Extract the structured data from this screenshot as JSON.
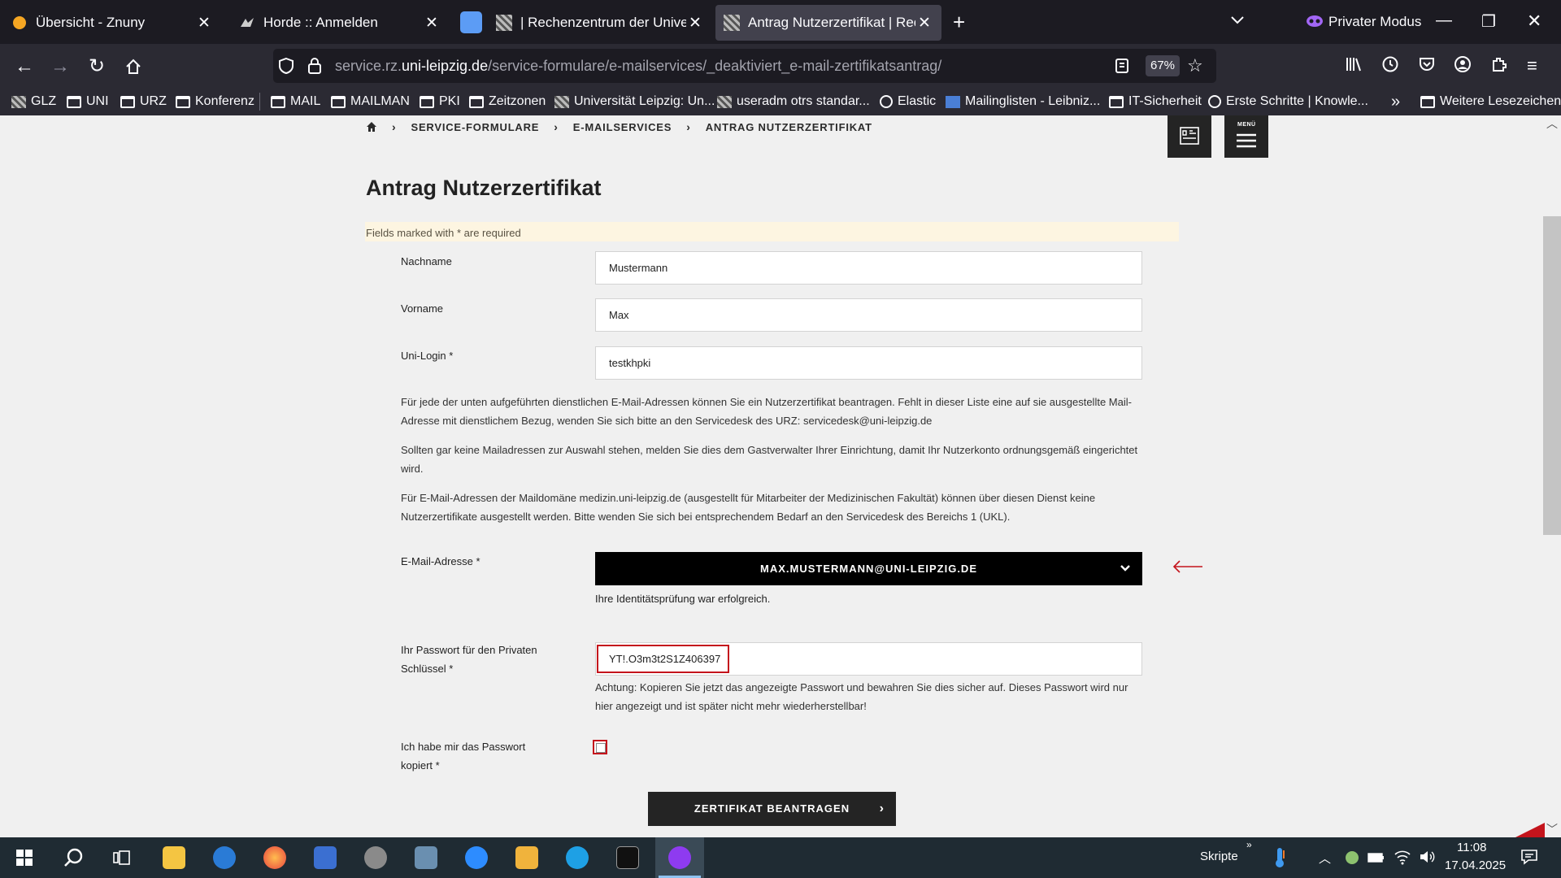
{
  "browser": {
    "tabs": [
      {
        "title": "Übersicht - Znuny",
        "active": false
      },
      {
        "title": "Horde :: Anmelden",
        "active": false
      },
      {
        "title": "| Rechenzentrum der Universität",
        "active": false
      },
      {
        "title": "Antrag Nutzerzertifikat | Rechen",
        "active": true
      }
    ],
    "private_mode_label": "Privater Modus",
    "url_prefix": "service.rz.",
    "url_domain": "uni-leipzig.de",
    "url_path": "/service-formulare/e-mailservices/_deaktiviert_e-mail-zertifikatsantrag/",
    "zoom": "67%",
    "bookmarks": [
      {
        "label": "GLZ",
        "icon": "image"
      },
      {
        "label": "UNI",
        "icon": "folder"
      },
      {
        "label": "URZ",
        "icon": "folder"
      },
      {
        "label": "Konferenz",
        "icon": "folder"
      },
      {
        "label": "MAIL",
        "icon": "folder"
      },
      {
        "label": "MAILMAN",
        "icon": "folder"
      },
      {
        "label": "PKI",
        "icon": "folder"
      },
      {
        "label": "Zeitzonen",
        "icon": "folder"
      },
      {
        "label": "Universität Leipzig: Un...",
        "icon": "image"
      },
      {
        "label": "useradm otrs standar...",
        "icon": "image"
      },
      {
        "label": "Elastic",
        "icon": "elastic"
      },
      {
        "label": "Mailinglisten - Leibniz...",
        "icon": "lrz"
      },
      {
        "label": "IT-Sicherheit",
        "icon": "folder"
      },
      {
        "label": "Erste Schritte | Knowle...",
        "icon": "globe"
      },
      {
        "label": "Weitere Lesezeichen",
        "icon": "folder"
      }
    ]
  },
  "page": {
    "breadcrumb": [
      "SERVICE-FORMULARE",
      "E-MAILSERVICES",
      "ANTRAG NUTZERZERTIFIKAT"
    ],
    "menu_label": "MENÜ",
    "title": "Antrag Nutzerzertifikat",
    "required_note": "Fields marked with * are required",
    "fields": {
      "nachname": {
        "label": "Nachname",
        "value": "Mustermann"
      },
      "vorname": {
        "label": "Vorname",
        "value": "Max"
      },
      "unilogin": {
        "label": "Uni-Login *",
        "value": "testkhpki"
      }
    },
    "paragraphs": [
      "Für jede der unten aufgeführten dienstlichen E-Mail-Adressen können Sie ein Nutzerzertifikat beantragen. Fehlt in dieser Liste eine auf sie ausgestellte Mail-Adresse mit dienstlichem Bezug, wenden Sie sich bitte an den Servicedesk des URZ: servicedesk@uni-leipzig.de",
      "Sollten gar keine Mailadressen zur Auswahl stehen, melden Sie dies dem Gastverwalter Ihrer Einrichtung, damit Ihr Nutzerkonto ordnungsgemäß eingerichtet wird.",
      "Für E-Mail-Adressen der Maildomäne medizin.uni-leipzig.de (ausgestellt für Mitarbeiter der Medizinischen Fakultät) können über diesen Dienst keine Nutzerzertifikate ausgestellt werden. Bitte wenden Sie sich bei entsprechendem Bedarf an den Servicedesk des Bereichs 1 (UKL)."
    ],
    "email": {
      "label": "E-Mail-Adresse *",
      "selected": "MAX.MUSTERMANN@UNI-LEIPZIG.DE",
      "status": "Ihre Identitätsprüfung war erfolgreich."
    },
    "password": {
      "label_line1": "Ihr Passwort für den Privaten",
      "label_line2": "Schlüssel *",
      "value": "YT!.O3m3t2S1Z406397",
      "warning": "Achtung: Kopieren Sie jetzt das angezeigte Passwort und bewahren Sie dies sicher auf. Dieses Passwort wird nur hier angezeigt und ist später nicht mehr wiederherstellbar!"
    },
    "confirm": {
      "label_line1": "Ich habe mir das Passwort",
      "label_line2": "kopiert *",
      "checked": false
    },
    "submit_label": "ZERTIFIKAT BEANTRAGEN"
  },
  "taskbar": {
    "tray_label": "Skripte",
    "time": "11:08",
    "date": "17.04.2025"
  },
  "colors": {
    "accent_red": "#c4141c",
    "dark_button": "#242424",
    "note_bg": "#fdf5e1"
  }
}
